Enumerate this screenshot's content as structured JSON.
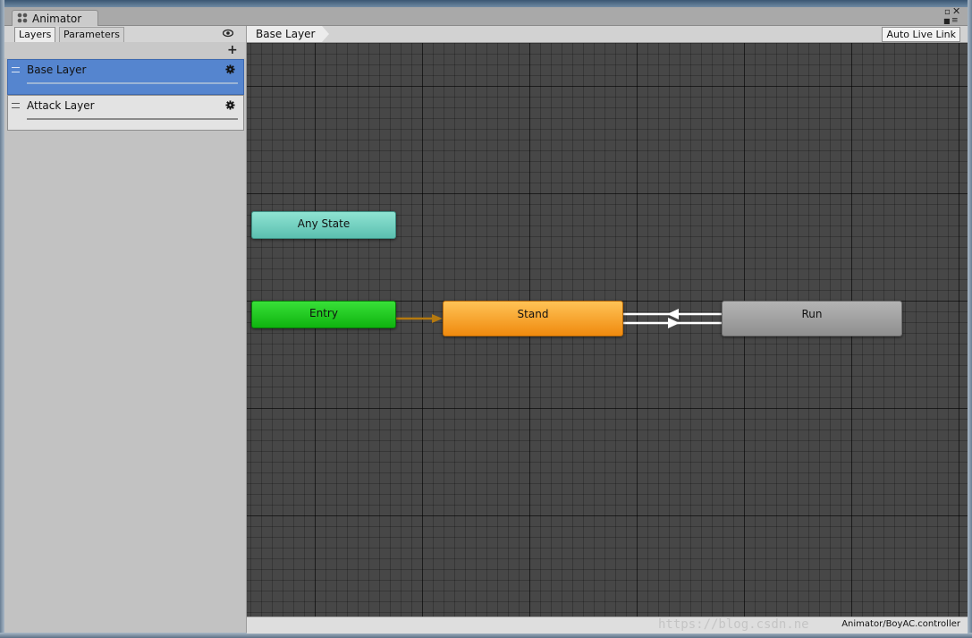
{
  "window": {
    "tab_title": "Animator",
    "tab_icon": "animator-icon"
  },
  "left_panel": {
    "tabs": [
      {
        "label": "Layers",
        "active": true
      },
      {
        "label": "Parameters",
        "active": false
      }
    ],
    "eye_icon": "eye-icon",
    "add_icon": "+",
    "layers": [
      {
        "label": "Base Layer",
        "selected": true,
        "gear_icon": "gear-icon"
      },
      {
        "label": "Attack Layer",
        "selected": false,
        "gear_icon": "gear-icon"
      }
    ]
  },
  "graph_header": {
    "breadcrumb": "Base Layer",
    "auto_live_link": "Auto Live Link"
  },
  "graph": {
    "nodes": {
      "any_state": "Any State",
      "entry": "Entry",
      "stand": "Stand",
      "run": "Run"
    },
    "colors": {
      "any_state": "#6fd1c0",
      "entry": "#1fc81f",
      "stand": "#f7a42a",
      "run": "#a3a3a3",
      "default_transition": "#b5790f",
      "transition": "#ffffff"
    }
  },
  "status_bar": {
    "controller_path": "Animator/BoyAC.controller",
    "watermark": "https://blog.csdn.ne"
  }
}
